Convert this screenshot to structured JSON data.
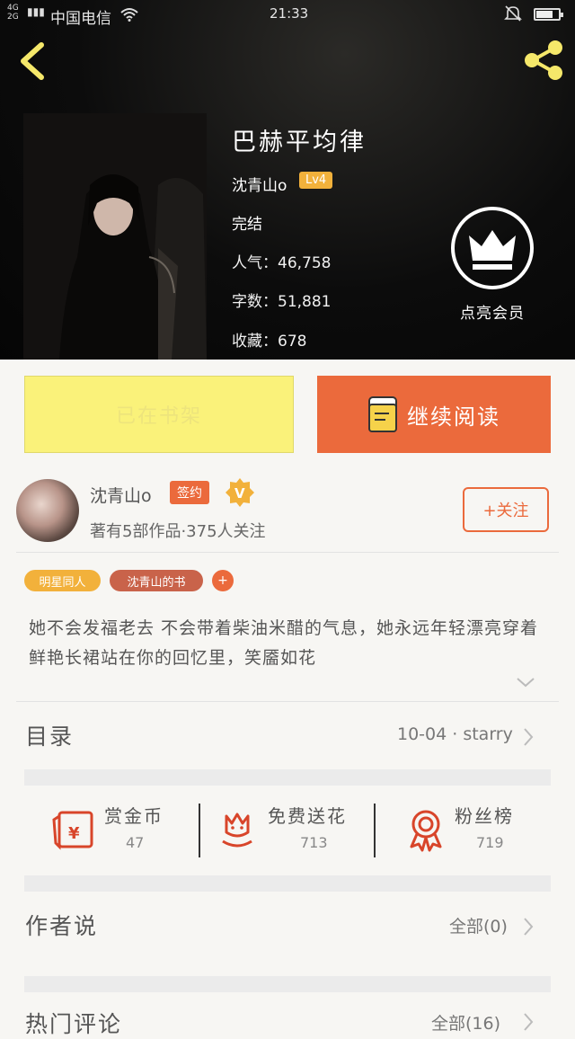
{
  "status_bar": {
    "network_top": "4G",
    "network_bottom": "2G",
    "carrier": "中国电信",
    "time": "21:33",
    "battery_level": 0.75
  },
  "nav": {
    "back_icon": "chevron-left-icon",
    "share_icon": "share-icon"
  },
  "book": {
    "title": "巴赫平均律",
    "author": "沈青山o",
    "level": "Lv4",
    "status": "完结",
    "popularity": "人气：46,758",
    "word_count": "字数：51,881",
    "favorites": "收藏：678",
    "vip_label": "点亮会员"
  },
  "actions": {
    "shelf_label": "已在书架",
    "read_label": "继续阅读"
  },
  "author_panel": {
    "name": "沈青山o",
    "signed_badge": "签约",
    "meta": "著有5部作品·375人关注",
    "follow_label": "+关注"
  },
  "tags": [
    "明星同人",
    "沈青山的书"
  ],
  "tag_add": "+",
  "description": "她不会发福老去 不会带着柴油米醋的气息，她永远年轻漂亮穿着鲜艳长裙站在你的回忆里，笑靥如花",
  "catalog": {
    "label": "目录",
    "latest": "10-04 · starry"
  },
  "rewards": [
    {
      "label": "赏金币",
      "count": "47"
    },
    {
      "label": "免费送花",
      "count": "713"
    },
    {
      "label": "粉丝榜",
      "count": "719"
    }
  ],
  "author_says": {
    "label": "作者说",
    "count": "全部(0)"
  },
  "hot_comments": {
    "label": "热门评论",
    "count": "全部(16)"
  },
  "colors": {
    "accent": "#eb6a3c",
    "shelf_button": "#faf27a",
    "level_badge": "#f2b13b",
    "reward_icon": "#d8452a"
  }
}
